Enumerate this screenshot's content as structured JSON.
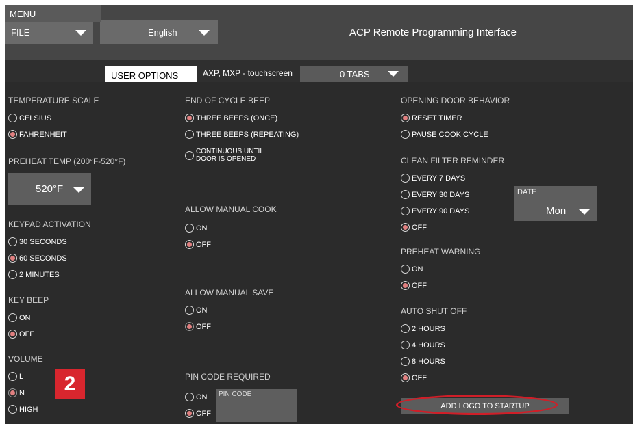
{
  "header": {
    "file_label": "FILE",
    "language_label": "English",
    "app_title": "ACP Remote Programming Interface"
  },
  "tabs": {
    "menu": "MENU",
    "user_options": "USER OPTIONS",
    "device": "AXP, MXP - touchscreen",
    "tabs_select": "0 TABS"
  },
  "col1": {
    "temperature_scale": {
      "heading": "TEMPERATURE SCALE",
      "options": [
        "CELSIUS",
        "FAHRENHEIT"
      ],
      "selected": "FAHRENHEIT"
    },
    "preheat_temp": {
      "heading": "PREHEAT TEMP (200°F-520°F)",
      "value": "520°F"
    },
    "keypad_activation": {
      "heading": "KEYPAD ACTIVATION",
      "options": [
        "30 SECONDS",
        "60 SECONDS",
        "2 MINUTES"
      ],
      "selected": "60 SECONDS"
    },
    "key_beep": {
      "heading": "KEY BEEP",
      "options": [
        "ON",
        "OFF"
      ],
      "selected": "OFF"
    },
    "volume": {
      "heading": "VOLUME",
      "options": [
        "L",
        "N",
        "HIGH"
      ],
      "selected": "N"
    }
  },
  "col2": {
    "end_of_cycle_beep": {
      "heading": "END OF CYCLE BEEP",
      "options": [
        "THREE BEEPS (ONCE)",
        "THREE BEEPS (REPEATING)",
        "CONTINUOUS UNTIL",
        "DOOR IS OPENED"
      ],
      "selected": "THREE BEEPS (ONCE)"
    },
    "allow_manual_cook": {
      "heading": "ALLOW MANUAL COOK",
      "options": [
        "ON",
        "OFF"
      ],
      "selected": "OFF"
    },
    "allow_manual_save": {
      "heading": "ALLOW MANUAL SAVE",
      "options": [
        "ON",
        "OFF"
      ],
      "selected": "OFF"
    },
    "pin_code_required": {
      "heading": "PIN CODE REQUIRED",
      "options": [
        "ON",
        "OFF"
      ],
      "selected": "OFF",
      "pin_placeholder": "PIN CODE"
    }
  },
  "col3": {
    "opening_door_behavior": {
      "heading": "OPENING DOOR BEHAVIOR",
      "options": [
        "RESET TIMER",
        "PAUSE COOK CYCLE"
      ],
      "selected": "RESET TIMER"
    },
    "clean_filter_reminder": {
      "heading": "CLEAN FILTER REMINDER",
      "options": [
        "EVERY 7 DAYS",
        "EVERY 30 DAYS",
        "EVERY 90 DAYS",
        "OFF"
      ],
      "selected": "OFF"
    },
    "date": {
      "label": "DATE",
      "value": "Mon"
    },
    "preheat_warning": {
      "heading": "PREHEAT WARNING",
      "options": [
        "ON",
        "OFF"
      ],
      "selected": "OFF"
    },
    "auto_shut_off": {
      "heading": "AUTO SHUT OFF",
      "options": [
        "2 HOURS",
        "4 HOURS",
        "8 HOURS",
        "OFF"
      ],
      "selected": "OFF"
    },
    "add_logo_button": "ADD LOGO TO STARTUP"
  },
  "annotation": {
    "badge": "2",
    "highlight_color": "#d01e28"
  },
  "colors": {
    "selected_radio": "#e08080",
    "panel": "#2b2b2b",
    "header": "#464646"
  }
}
